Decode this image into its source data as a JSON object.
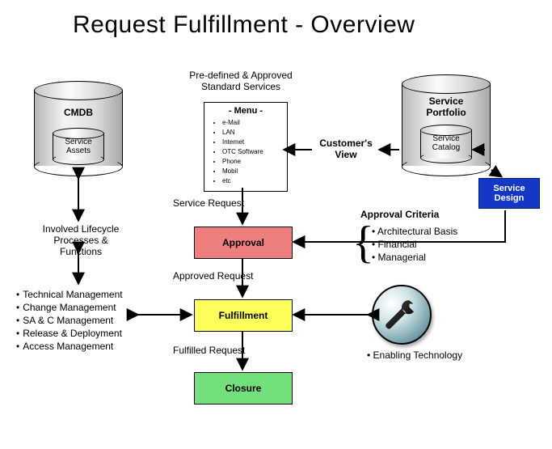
{
  "title": "Request Fulfillment - Overview",
  "cmdb": {
    "label": "CMDB",
    "inner": "Service\nAssets"
  },
  "portfolio": {
    "label": "Service\nPortfolio",
    "inner": "Service\nCatalog"
  },
  "menu": {
    "heading_top": "Pre-defined & Approved\nStandard Services",
    "title": "- Menu -",
    "items": [
      "e-Mail",
      "LAN",
      "Internet",
      "OTC Software",
      "Phone",
      "Mobil",
      "etc"
    ]
  },
  "labels": {
    "customers_view": "Customer's\nView",
    "service_design": "Service\nDesign",
    "service_request": "Service Request",
    "approval": "Approval",
    "approved_request": "Approved Request",
    "fulfillment": "Fulfillment",
    "fulfilled_request": "Fulfilled Request",
    "closure": "Closure",
    "approval_criteria_title": "Approval Criteria",
    "enabling_tech": "• Enabling Technology",
    "lifecycle": "Involved Lifecycle\nProcesses & Functions"
  },
  "approval_criteria": [
    "Architectural Basis",
    "Financial",
    "Managerial"
  ],
  "processes": [
    "Technical Management",
    "Change Management",
    "SA & C Management",
    "Release & Deployment",
    "Access Management"
  ]
}
